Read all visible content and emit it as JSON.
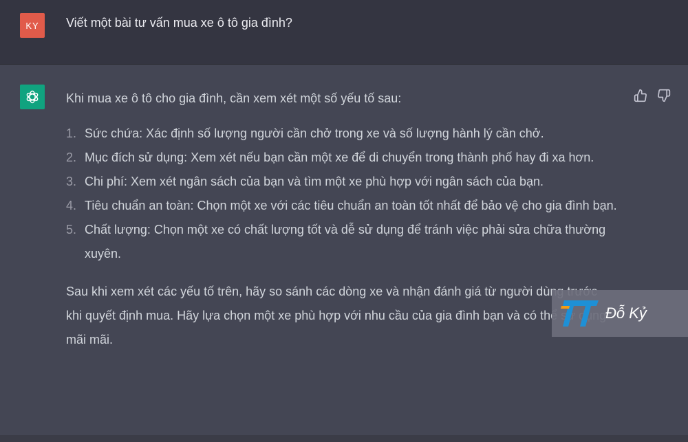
{
  "user": {
    "avatar_initials": "KY",
    "message": "Viết một bài tư vấn mua xe ô tô gia đình?"
  },
  "assistant": {
    "avatar_icon": "openai-logo-icon",
    "intro": "Khi mua xe ô tô cho gia đình, cần xem xét một số yếu tố sau:",
    "points": [
      {
        "num": "1.",
        "text": "Sức chứa: Xác định số lượng người cần chở trong xe và số lượng hành lý cần chở."
      },
      {
        "num": "2.",
        "text": "Mục đích sử dụng: Xem xét nếu bạn cần một xe để di chuyển trong thành phố hay đi xa hơn."
      },
      {
        "num": "3.",
        "text": "Chi phí: Xem xét ngân sách của bạn và tìm một xe phù hợp với ngân sách của bạn."
      },
      {
        "num": "4.",
        "text": "Tiêu chuẩn an toàn: Chọn một xe với các tiêu chuẩn an toàn tốt nhất để bảo vệ cho gia đình bạn."
      },
      {
        "num": "5.",
        "text": "Chất lượng: Chọn một xe có chất lượng tốt và dễ sử dụng để tránh việc phải sửa chữa thường xuyên."
      }
    ],
    "outro": "Sau khi xem xét các yếu tố trên, hãy so sánh các dòng xe và nhận đánh giá từ người dùng trước khi quyết định mua. Hãy lựa chọn một xe phù hợp với nhu cầu của gia đình bạn và có thể sử dụng mãi mãi."
  },
  "feedback": {
    "up_icon": "thumbs-up-icon",
    "down_icon": "thumbs-down-icon"
  },
  "watermark": {
    "text": "Đỗ Kỷ",
    "logo_icon": "tt-logo-icon"
  },
  "colors": {
    "user_bg": "#343541",
    "assistant_bg": "#444654",
    "user_avatar": "#e15b4a",
    "bot_avatar": "#10a37f",
    "text": "#d1d5db",
    "logo_blue": "#1e90d6",
    "logo_orange": "#f39c12"
  }
}
